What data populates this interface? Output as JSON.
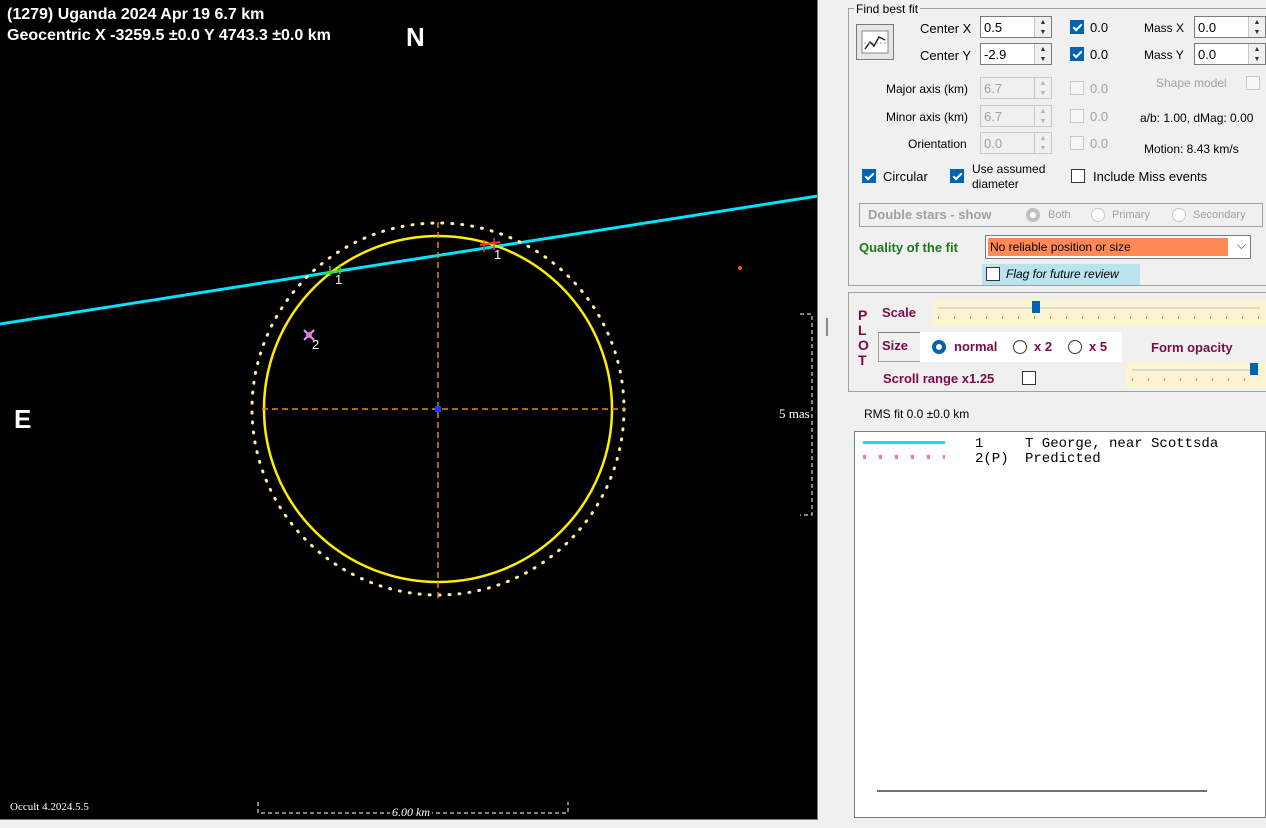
{
  "plot": {
    "title_line1": "(1279) Uganda  2024 Apr 19   6.7 km",
    "title_line2": "Geocentric  X  -3259.5 ±0.0  Y 4743.3 ±0.0 km",
    "north_label": "N",
    "east_label": "E",
    "scale_km_label": "6.00 km",
    "scale_mas_label": "5 mas",
    "chord_label_1a": "1",
    "chord_label_1b": "1",
    "predicted_label": "2",
    "version": "Occult 4.2024.5.5",
    "colors": {
      "ellipse": "#ffee00",
      "chord": "#00e5ff",
      "axes": "#e08a00",
      "limb": "#fff0a0"
    }
  },
  "fit": {
    "section_title": "Find best fit",
    "fit_button_icon": "chart-fit-icon",
    "center_x_label": "Center X",
    "center_x_value": "0.5",
    "center_x_check_label": "0.0",
    "center_y_label": "Center Y",
    "center_y_value": "-2.9",
    "center_y_check_label": "0.0",
    "mass_x_label": "Mass X",
    "mass_x_value": "0.0",
    "mass_y_label": "Mass Y",
    "mass_y_value": "0.0",
    "major_axis_label": "Major axis (km)",
    "major_axis_value": "6.7",
    "major_check_label": "0.0",
    "minor_axis_label": "Minor axis (km)",
    "minor_axis_value": "6.7",
    "minor_check_label": "0.0",
    "orientation_label": "Orientation",
    "orientation_value": "0.0",
    "orientation_check_label": "0.0",
    "shape_model_label": "Shape model",
    "ab_label": "a/b: 1.00, dMag: 0.00",
    "motion_label": "Motion: 8.43 km/s",
    "circular_label": "Circular",
    "assumed_diameter_label": "Use assumed diameter",
    "include_miss_label": "Include Miss events",
    "double_stars_label": "Double stars - show",
    "both_label": "Both",
    "primary_label": "Primary",
    "secondary_label": "Secondary",
    "quality_label": "Quality of the fit",
    "quality_value": "No reliable position or size",
    "flag_label": "Flag for future review"
  },
  "plotopts": {
    "plot_letters": "PLOT",
    "scale_label": "Scale",
    "scale_level": 0.3,
    "size_label": "Size",
    "size_normal": "normal",
    "size_x2": "x 2",
    "size_x5": "x 5",
    "form_opacity_label": "Form opacity",
    "opacity_level": 0.98,
    "scroll_range_label": "Scroll range x1.25"
  },
  "rms": {
    "label": "RMS fit 0.0 ±0.0 km",
    "legend": [
      {
        "num": "1",
        "text": "T George, near Scottsda"
      },
      {
        "num": "2(P)",
        "text": "Predicted"
      }
    ]
  }
}
